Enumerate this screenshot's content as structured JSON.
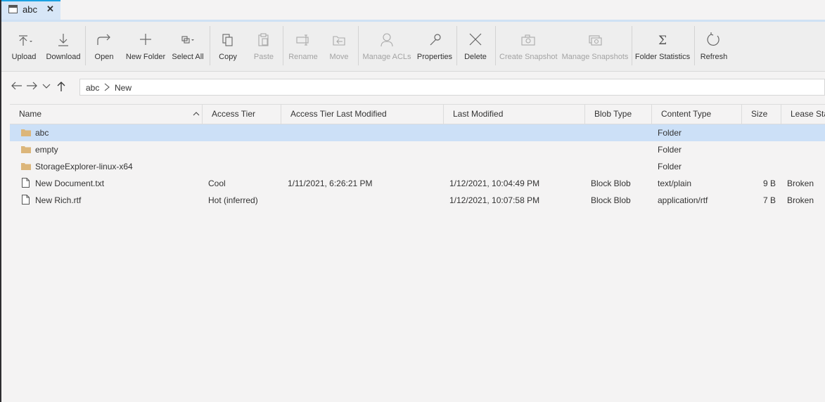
{
  "tab": {
    "title": "abc",
    "close": "✕"
  },
  "toolbar": {
    "upload": "Upload",
    "download": "Download",
    "open": "Open",
    "new_folder": "New Folder",
    "select_all": "Select All",
    "copy": "Copy",
    "paste": "Paste",
    "rename": "Rename",
    "move": "Move",
    "manage_acls": "Manage ACLs",
    "properties": "Properties",
    "delete": "Delete",
    "create_snapshot": "Create Snapshot",
    "manage_snapshots": "Manage Snapshots",
    "folder_statistics": "Folder Statistics",
    "refresh": "Refresh"
  },
  "breadcrumb": [
    "abc",
    "New"
  ],
  "columns": {
    "name": "Name",
    "access_tier": "Access Tier",
    "access_tier_last_modified": "Access Tier Last Modified",
    "last_modified": "Last Modified",
    "blob_type": "Blob Type",
    "content_type": "Content Type",
    "size": "Size",
    "lease_state": "Lease Sta"
  },
  "rows": [
    {
      "name": "abc",
      "icon": "folder-icon",
      "access_tier": "",
      "tier_modified": "",
      "last_modified": "",
      "blob_type": "",
      "content_type": "Folder",
      "size": "",
      "lease": ""
    },
    {
      "name": "empty",
      "icon": "folder-icon",
      "access_tier": "",
      "tier_modified": "",
      "last_modified": "",
      "blob_type": "",
      "content_type": "Folder",
      "size": "",
      "lease": ""
    },
    {
      "name": "StorageExplorer-linux-x64",
      "icon": "folder-icon",
      "access_tier": "",
      "tier_modified": "",
      "last_modified": "",
      "blob_type": "",
      "content_type": "Folder",
      "size": "",
      "lease": ""
    },
    {
      "name": "New Document.txt",
      "icon": "file-icon",
      "access_tier": "Cool",
      "tier_modified": "1/11/2021, 6:26:21 PM",
      "last_modified": "1/12/2021, 10:04:49 PM",
      "blob_type": "Block Blob",
      "content_type": "text/plain",
      "size": "9 B",
      "lease": "Broken"
    },
    {
      "name": "New Rich.rtf",
      "icon": "file-icon",
      "access_tier": "Hot (inferred)",
      "tier_modified": "",
      "last_modified": "1/12/2021, 10:07:58 PM",
      "blob_type": "Block Blob",
      "content_type": "application/rtf",
      "size": "7 B",
      "lease": "Broken"
    }
  ],
  "colors": {
    "selection": "#cce0f7",
    "folder": "#dcb67a",
    "tab_accent": "#1ba1e2"
  }
}
